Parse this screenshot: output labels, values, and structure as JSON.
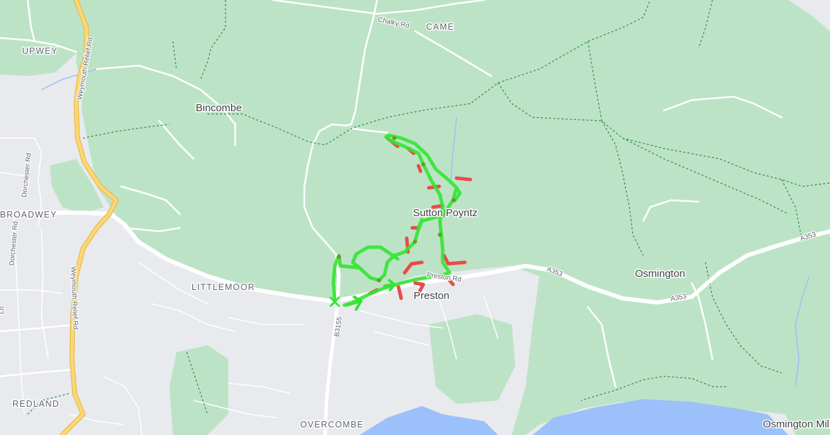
{
  "map": {
    "colors": {
      "land_urban": "#e8eaed",
      "land_green": "#bde3c6",
      "water": "#9cc0f9",
      "road": "#ffffff",
      "trunk_road": "#fbd774",
      "trunk_road_edge": "#e5b53b",
      "route": "#33e633",
      "off_route": "#e84b4b",
      "boundary": "#2e8b3e"
    },
    "place_labels": {
      "upwey": "UPWEY",
      "came": "CAME",
      "bincombe": "Bincombe",
      "broadwey": "BROADWEY",
      "sutton_poyntz": "Sutton Poyntz",
      "littlemoor": "LITTLEMOOR",
      "preston": "Preston",
      "osmington": "Osmington",
      "redland": "REDLAND",
      "overcombe": "OVERCOMBE",
      "osmington_mills": "Osmington Mills"
    },
    "road_labels": {
      "chalky_rd": "Chalky Rd",
      "weymouth_relief_rd_north": "Weymouth Relief Rd",
      "weymouth_relief_rd_south": "Weymouth Relief Rd",
      "dorchester_rd_north": "Dorchester Rd",
      "dorchester_rd_south": "Dorchester Rd",
      "preston_rd": "Preston Rd",
      "a353_east": "A353",
      "a353_middle": "A353",
      "a353_west": "A353",
      "b3155": "B3155",
      "ln": "Ln"
    },
    "route_marker_icon": "start-x-marker",
    "direction_arrow_icon": "route-direction-arrow"
  }
}
